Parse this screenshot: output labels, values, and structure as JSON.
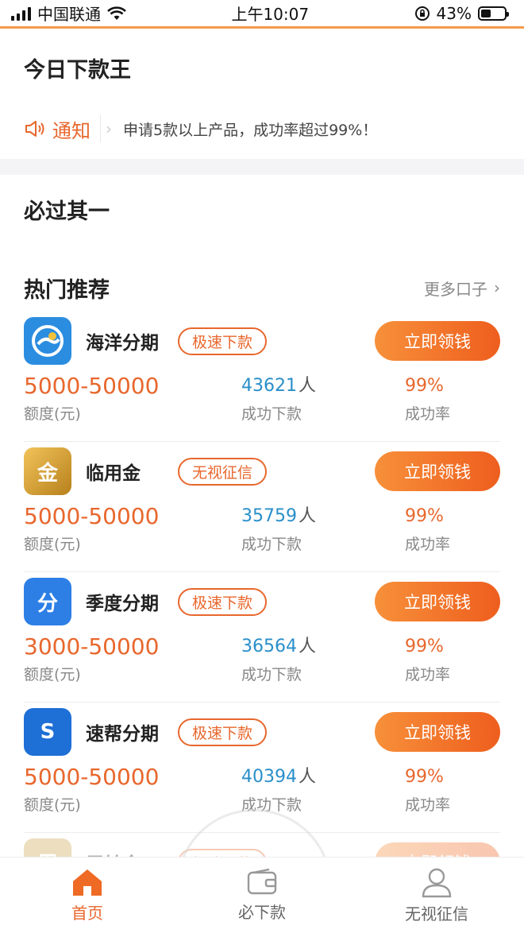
{
  "status_bar": {
    "carrier": "中国联通",
    "time": "上午10:07",
    "battery": "43%",
    "battery_level": 0.43
  },
  "header": {
    "title": "今日下款王"
  },
  "notice": {
    "tag": "通知",
    "text": "申请5款以上产品，成功率超过99%！"
  },
  "must_pass": {
    "title": "必过其一"
  },
  "hot": {
    "title": "热门推荐",
    "more": "更多口子"
  },
  "products": [
    {
      "name": "海洋分期",
      "badge": "极速下款",
      "cta": "立即领钱",
      "amount": "5000-50000",
      "amount_label": "额度(元)",
      "count": "43621",
      "count_unit": "人",
      "count_label": "成功下款",
      "rate": "99%",
      "rate_label": "成功率",
      "logo_color": "#2b8de0",
      "logo_icon": "wave-logo-icon",
      "logo_text": ""
    },
    {
      "name": "临用金",
      "badge": "无视征信",
      "cta": "立即领钱",
      "amount": "5000-50000",
      "amount_label": "额度(元)",
      "count": "35759",
      "count_unit": "人",
      "count_label": "成功下款",
      "rate": "99%",
      "rate_label": "成功率",
      "logo_color": "#d89a2a",
      "logo_icon": "gold-logo-icon",
      "logo_text": "金"
    },
    {
      "name": "季度分期",
      "badge": "极速下款",
      "cta": "立即领钱",
      "amount": "3000-50000",
      "amount_label": "额度(元)",
      "count": "36564",
      "count_unit": "人",
      "count_label": "成功下款",
      "rate": "99%",
      "rate_label": "成功率",
      "logo_color": "#2d7fe6",
      "logo_icon": "quarter-logo-icon",
      "logo_text": "分"
    },
    {
      "name": "速帮分期",
      "badge": "极速下款",
      "cta": "立即领钱",
      "amount": "5000-50000",
      "amount_label": "额度(元)",
      "count": "40394",
      "count_unit": "人",
      "count_label": "成功下款",
      "rate": "99%",
      "rate_label": "成功率",
      "logo_color": "#1e6fd6",
      "logo_icon": "subang-logo-icon",
      "logo_text": "S"
    },
    {
      "name": "周转金",
      "badge": "极速下款",
      "cta": "立即领钱",
      "logo_color": "#c9a24a",
      "logo_icon": "turnover-logo-icon",
      "logo_text": "周"
    }
  ],
  "tabs": [
    {
      "label": "首页",
      "icon": "home-icon",
      "active": true
    },
    {
      "label": "必下款",
      "icon": "wallet-icon",
      "active": false
    },
    {
      "label": "无视征信",
      "icon": "user-icon",
      "active": false
    }
  ],
  "colors": {
    "accent": "#e8672d",
    "count_blue": "#2a8fc9"
  }
}
